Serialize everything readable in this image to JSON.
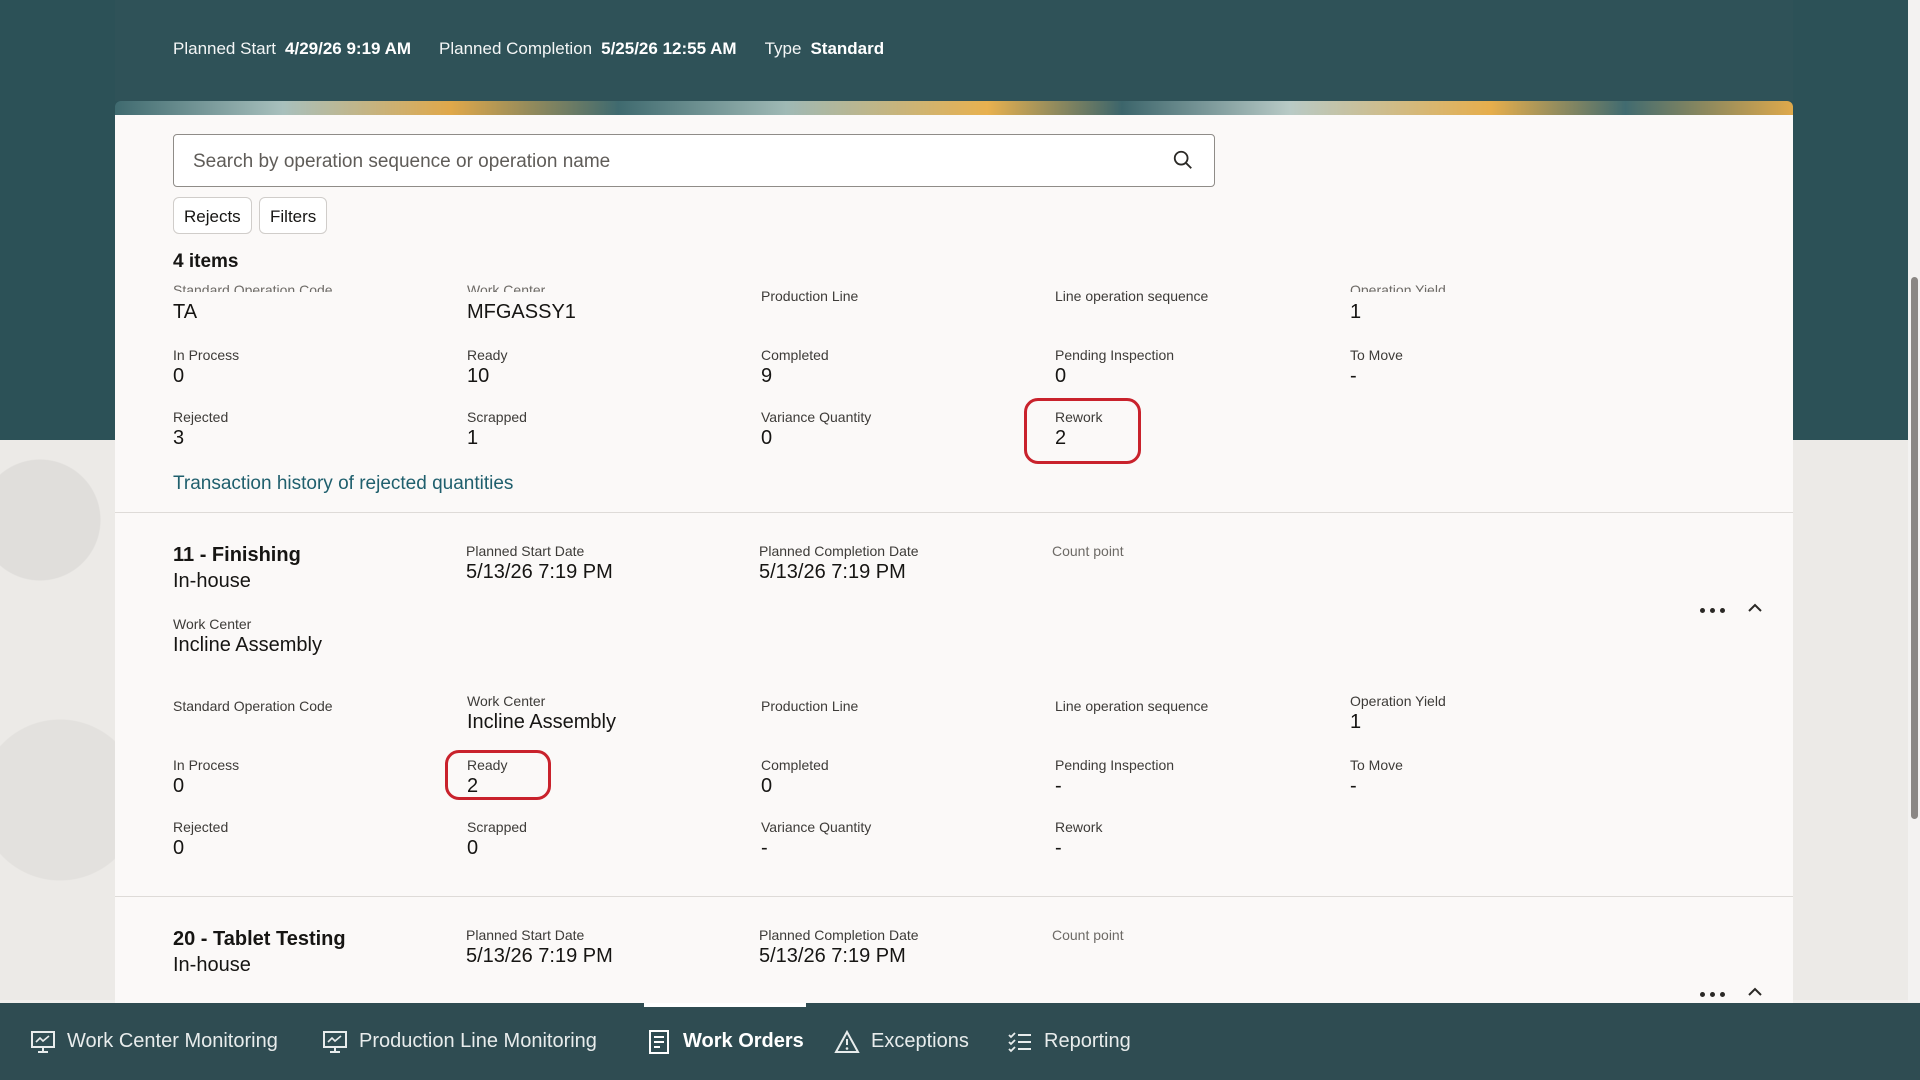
{
  "header": {
    "planned_start_label": "Planned Start",
    "planned_start_value": "4/29/26 9:19 AM",
    "planned_completion_label": "Planned Completion",
    "planned_completion_value": "5/25/26 12:55 AM",
    "type_label": "Type",
    "type_value": "Standard"
  },
  "search": {
    "placeholder": "Search by operation sequence or operation name"
  },
  "chips": {
    "rejects": "Rejects",
    "filters": "Filters"
  },
  "item_count": "4 items",
  "op1": {
    "standard_operation_code_label": "Standard Operation Code",
    "standard_operation_code_value": "TA",
    "work_center_label": "Work Center",
    "work_center_value": "MFGASSY1",
    "production_line_label": "Production Line",
    "line_operation_sequence_label": "Line operation sequence",
    "operation_yield_label": "Operation Yield",
    "operation_yield_value": "1",
    "in_process_label": "In Process",
    "in_process_value": "0",
    "ready_label": "Ready",
    "ready_value": "10",
    "completed_label": "Completed",
    "completed_value": "9",
    "pending_inspection_label": "Pending Inspection",
    "pending_inspection_value": "0",
    "to_move_label": "To Move",
    "to_move_value": "-",
    "rejected_label": "Rejected",
    "rejected_value": "3",
    "scrapped_label": "Scrapped",
    "scrapped_value": "1",
    "variance_quantity_label": "Variance Quantity",
    "variance_quantity_value": "0",
    "rework_label": "Rework",
    "rework_value": "2",
    "history_link": "Transaction history of rejected quantities"
  },
  "op2": {
    "title": "11 - Finishing",
    "subtitle": "In-house",
    "planned_start_date_label": "Planned Start Date",
    "planned_start_date_value": "5/13/26 7:19 PM",
    "planned_completion_date_label": "Planned Completion Date",
    "planned_completion_date_value": "5/13/26 7:19 PM",
    "count_point_label": "Count point",
    "work_center_header_label": "Work Center",
    "work_center_header_value": "Incline Assembly",
    "standard_operation_code_label": "Standard Operation Code",
    "work_center_label": "Work Center",
    "work_center_value": "Incline Assembly",
    "production_line_label": "Production Line",
    "line_operation_sequence_label": "Line operation sequence",
    "operation_yield_label": "Operation Yield",
    "operation_yield_value": "1",
    "in_process_label": "In Process",
    "in_process_value": "0",
    "ready_label": "Ready",
    "ready_value": "2",
    "completed_label": "Completed",
    "completed_value": "0",
    "pending_inspection_label": "Pending Inspection",
    "pending_inspection_value": "-",
    "to_move_label": "To Move",
    "to_move_value": "-",
    "rejected_label": "Rejected",
    "rejected_value": "0",
    "scrapped_label": "Scrapped",
    "scrapped_value": "0",
    "variance_quantity_label": "Variance Quantity",
    "variance_quantity_value": "-",
    "rework_label": "Rework",
    "rework_value": "-"
  },
  "op3": {
    "title": "20 - Tablet Testing",
    "subtitle": "In-house",
    "planned_start_date_label": "Planned Start Date",
    "planned_start_date_value": "5/13/26 7:19 PM",
    "planned_completion_date_label": "Planned Completion Date",
    "planned_completion_date_value": "5/13/26 7:19 PM",
    "count_point_label": "Count point"
  },
  "bottom_nav": {
    "items": [
      {
        "label": "Work Center Monitoring",
        "icon": "monitor-icon"
      },
      {
        "label": "Production Line Monitoring",
        "icon": "monitor-icon"
      },
      {
        "label": "Work Orders",
        "icon": "document-icon",
        "active": true
      },
      {
        "label": "Exceptions",
        "icon": "warning-icon"
      },
      {
        "label": "Reporting",
        "icon": "checklist-icon"
      }
    ]
  },
  "colors": {
    "header_teal": "#2f5258",
    "nav": "#2f4c52",
    "highlight": "#c9222c",
    "link": "#1f5f6d"
  }
}
